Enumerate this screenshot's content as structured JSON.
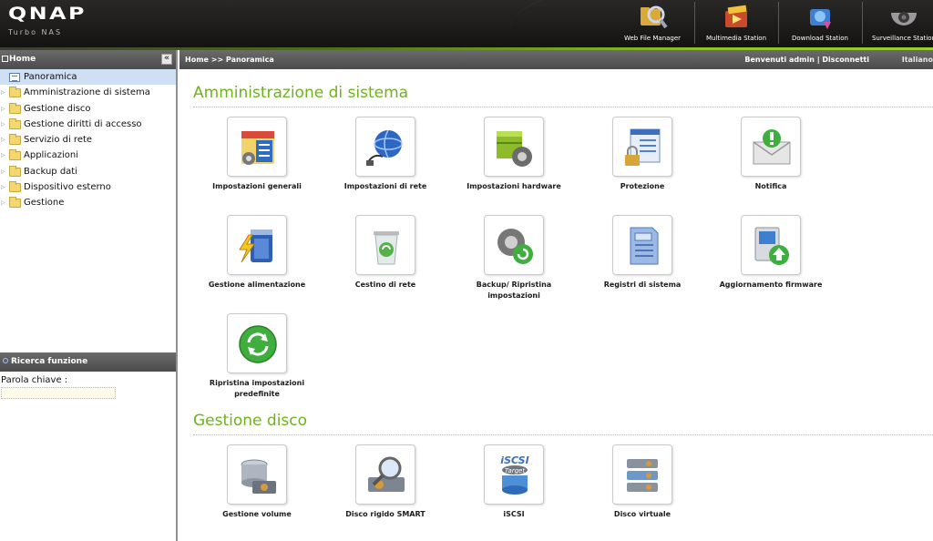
{
  "brand": {
    "logo": "QNAP",
    "subtitle": "Turbo NAS"
  },
  "apps": [
    {
      "label": "Web File Manager",
      "icon": "web-file-manager-icon"
    },
    {
      "label": "Multimedia Station",
      "icon": "multimedia-station-icon"
    },
    {
      "label": "Download Station",
      "icon": "download-station-icon"
    },
    {
      "label": "Surveillance Station",
      "icon": "surveillance-station-icon"
    }
  ],
  "sidebar": {
    "header": "Home",
    "collapse_glyph": "«",
    "items": [
      {
        "label": "Panoramica",
        "selected": true
      },
      {
        "label": "Amministrazione di sistema"
      },
      {
        "label": "Gestione disco"
      },
      {
        "label": "Gestione diritti di accesso"
      },
      {
        "label": "Servizio di rete"
      },
      {
        "label": "Applicazioni"
      },
      {
        "label": "Backup dati"
      },
      {
        "label": "Dispositivo esterno"
      },
      {
        "label": "Gestione"
      }
    ],
    "search": {
      "header": "Ricerca funzione",
      "keyword_label": "Parola chiave :",
      "keyword_value": ""
    }
  },
  "crumbbar": {
    "breadcrumb": "Home >> Panoramica",
    "welcome": "Benvenuti admin | Disconnetti",
    "language": "Italiano"
  },
  "sections": [
    {
      "title": "Amministrazione di sistema",
      "tiles": [
        {
          "label": "Impostazioni generali",
          "icon": "general-settings-icon"
        },
        {
          "label": "Impostazioni di rete",
          "icon": "network-settings-icon"
        },
        {
          "label": "Impostazioni hardware",
          "icon": "hardware-settings-icon"
        },
        {
          "label": "Protezione",
          "icon": "security-lock-icon"
        },
        {
          "label": "Notifica",
          "icon": "notification-envelope-icon"
        },
        {
          "label": "Gestione alimentazione",
          "icon": "power-management-icon"
        },
        {
          "label": "Cestino di rete",
          "icon": "network-recycle-bin-icon"
        },
        {
          "label": "Backup/ Ripristina impostazioni",
          "icon": "backup-restore-gear-icon"
        },
        {
          "label": "Registri di sistema",
          "icon": "system-log-icon"
        },
        {
          "label": "Aggiornamento firmware",
          "icon": "firmware-update-icon"
        },
        {
          "label": "Ripristina impostazioni predefinite",
          "icon": "restore-defaults-icon"
        }
      ]
    },
    {
      "title": "Gestione disco",
      "tiles": [
        {
          "label": "Gestione volume",
          "icon": "volume-management-icon"
        },
        {
          "label": "Disco rigido SMART",
          "icon": "hdd-smart-icon"
        },
        {
          "label": "iSCSI",
          "icon": "iscsi-target-icon",
          "badge_top": "iSCSI",
          "badge_bottom": "Target"
        },
        {
          "label": "Disco virtuale",
          "icon": "virtual-disk-icon"
        }
      ]
    }
  ],
  "colors": {
    "accent_green": "#6eb21e",
    "header_dark": "#1d1c1b",
    "panel_head": "#555555",
    "selected_row": "#cfe0f5"
  }
}
